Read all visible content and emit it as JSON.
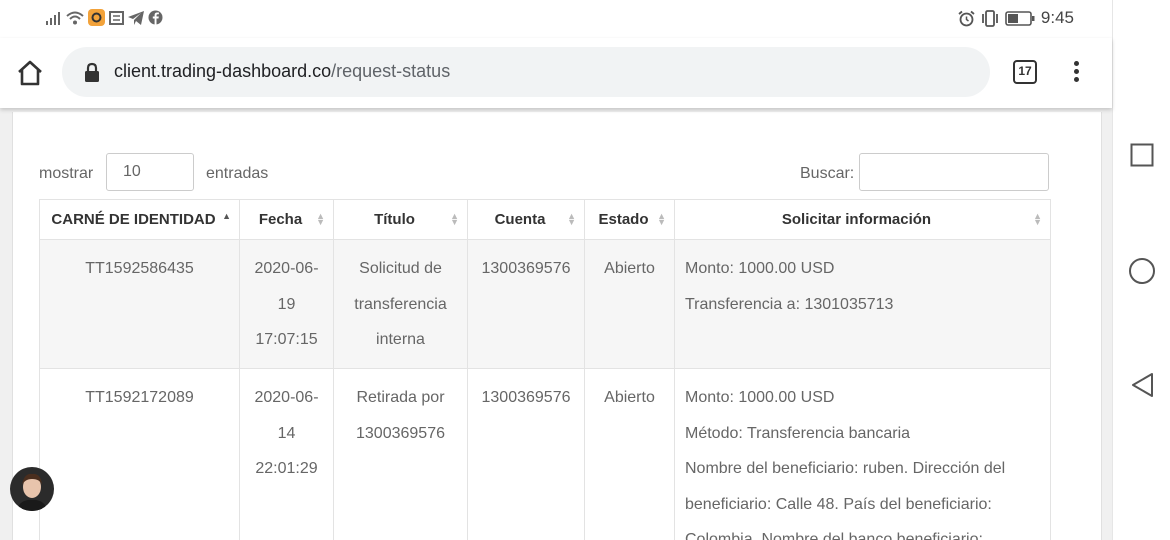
{
  "status_bar": {
    "time": "9:45",
    "notification_icons": [
      "signal-icon",
      "wifi-icon",
      "app-icon",
      "news-icon",
      "telegram-icon",
      "facebook-icon"
    ]
  },
  "browser": {
    "url_domain": "client.trading-dashboard.co",
    "url_path": "/request-status",
    "tab_count": "17"
  },
  "table_controls": {
    "length_prefix": "mostrar",
    "length_value": "10",
    "length_suffix": "entradas",
    "search_label": "Buscar:"
  },
  "table": {
    "headers": [
      "CARNÉ DE IDENTIDAD",
      "Fecha",
      "Título",
      "Cuenta",
      "Estado",
      "Solicitar información"
    ],
    "rows": [
      {
        "id": "TT1592586435",
        "date": [
          "2020-06-",
          "19",
          "17:07:15"
        ],
        "title": [
          "Solicitud de",
          "transferencia",
          "interna"
        ],
        "account": "1300369576",
        "status": "Abierto",
        "info": [
          "Monto: 1000.00 USD",
          "Transferencia a: 1301035713"
        ]
      },
      {
        "id": "TT1592172089",
        "date": [
          "2020-06-",
          "14",
          "22:01:29"
        ],
        "title": [
          "Retirada por",
          "1300369576"
        ],
        "account": "1300369576",
        "status": "Abierto",
        "info": [
          "Monto: 1000.00 USD",
          "Método: Transferencia bancaria",
          "Nombre del beneficiario: ruben. Dirección del",
          "beneficiario: Calle 48. País del beneficiario:",
          "Colombia. Nombre del banco beneficiario:"
        ]
      }
    ]
  },
  "colors": {
    "accent": "#333333",
    "stripe": "#f6f6f6",
    "border": "#e3e3e3"
  }
}
